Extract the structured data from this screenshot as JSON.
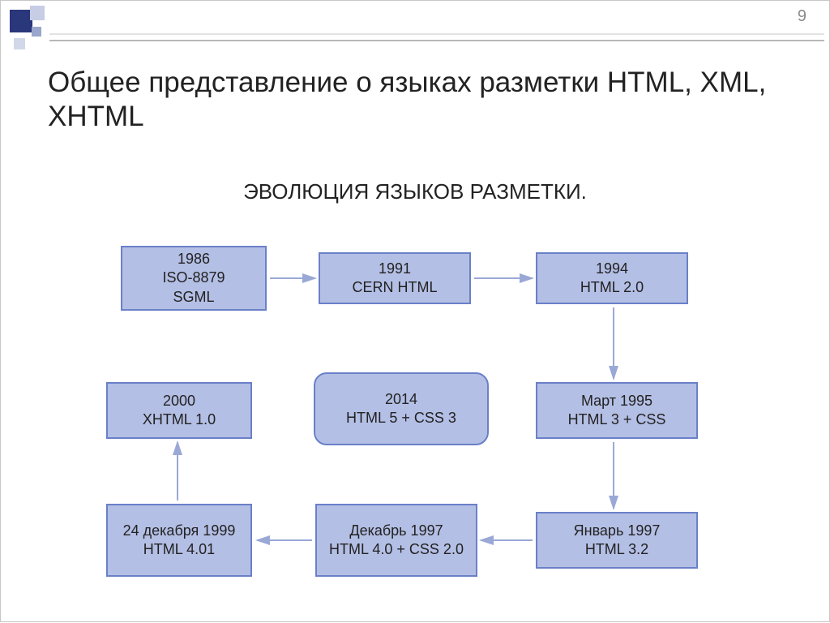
{
  "page_number": "9",
  "title": "Общее представление о языках разметки HTML, XML, XHTML",
  "subtitle": "ЭВОЛЮЦИЯ ЯЗЫКОВ РАЗМЕТКИ.",
  "nodes": {
    "n1": "1986\nISO-8879\nSGML",
    "n2": "1991\nCERN HTML",
    "n3": "1994\nHTML 2.0",
    "n4": "2000\nXHTML 1.0",
    "n5": "2014\nHTML 5 + CSS 3",
    "n6": "Март 1995\nHTML 3 +  CSS",
    "n7": "24 декабря 1999\nHTML 4.01",
    "n8": "Декабрь 1997\nHTML 4.0 + CSS 2.0",
    "n9": "Январь 1997\nHTML 3.2"
  },
  "chart_data": {
    "type": "flow-diagram",
    "title": "ЭВОЛЮЦИЯ ЯЗЫКОВ РАЗМЕТКИ.",
    "nodes": [
      {
        "id": "n1",
        "label": "1986 ISO-8879 SGML",
        "year": 1986
      },
      {
        "id": "n2",
        "label": "1991 CERN HTML",
        "year": 1991
      },
      {
        "id": "n3",
        "label": "1994 HTML 2.0",
        "year": 1994
      },
      {
        "id": "n6",
        "label": "Март 1995 HTML 3 + CSS",
        "year": 1995
      },
      {
        "id": "n9",
        "label": "Январь 1997 HTML 3.2",
        "year": 1997
      },
      {
        "id": "n8",
        "label": "Декабрь 1997 HTML 4.0 + CSS 2.0",
        "year": 1997
      },
      {
        "id": "n7",
        "label": "24 декабря 1999 HTML 4.01",
        "year": 1999
      },
      {
        "id": "n4",
        "label": "2000 XHTML 1.0",
        "year": 2000
      },
      {
        "id": "n5",
        "label": "2014 HTML 5 + CSS 3",
        "year": 2014,
        "highlight": true
      }
    ],
    "edges": [
      [
        "n1",
        "n2"
      ],
      [
        "n2",
        "n3"
      ],
      [
        "n3",
        "n6"
      ],
      [
        "n6",
        "n9"
      ],
      [
        "n9",
        "n8"
      ],
      [
        "n8",
        "n7"
      ],
      [
        "n7",
        "n4"
      ]
    ]
  }
}
